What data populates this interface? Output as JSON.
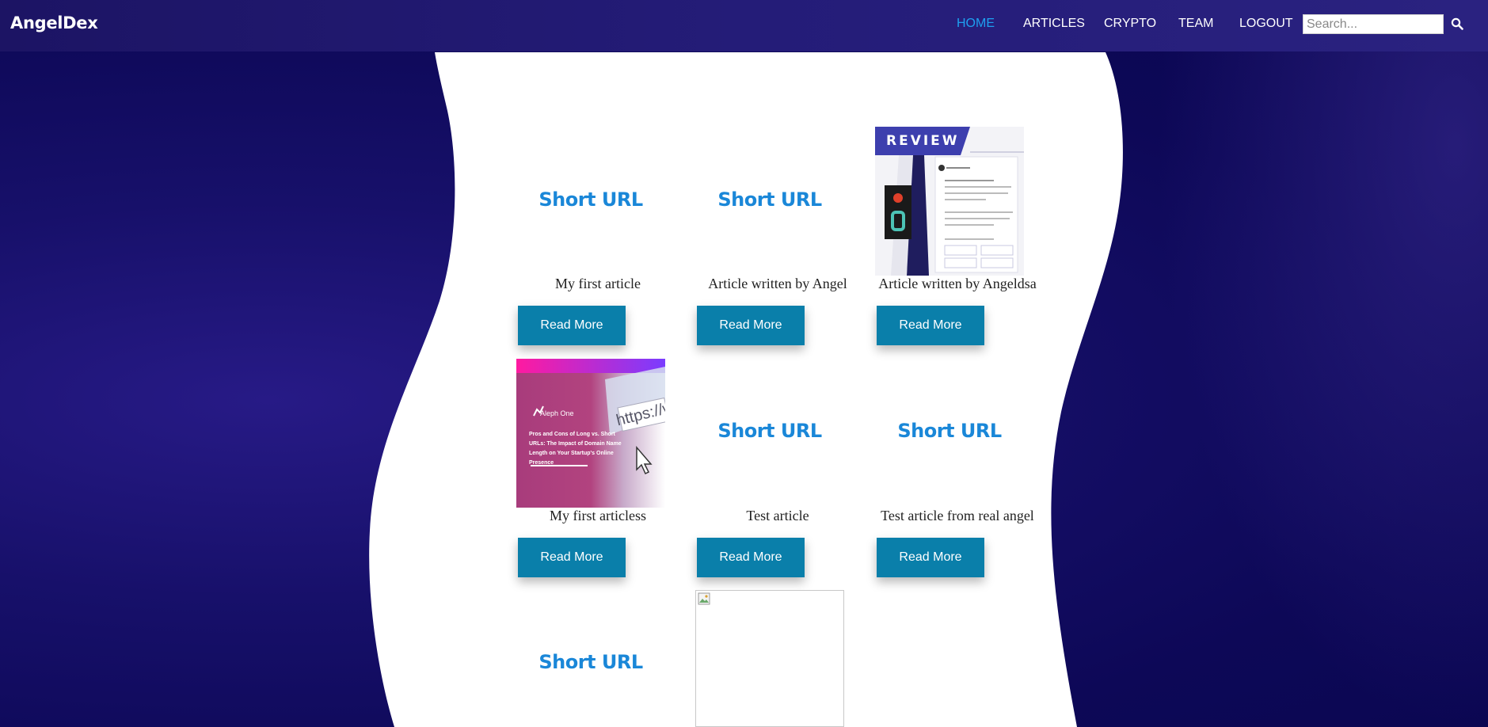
{
  "app": {
    "brand": "AngelDex"
  },
  "nav": {
    "items": [
      {
        "label": "HOME",
        "active": true
      },
      {
        "label": "ARTICLES",
        "active": false
      },
      {
        "label": "CRYPTO",
        "active": false
      },
      {
        "label": "TEAM",
        "active": false
      },
      {
        "label": "LOGOUT",
        "active": false
      }
    ],
    "search": {
      "placeholder": "Search...",
      "value": "",
      "icon": "search-icon"
    }
  },
  "articles": [
    {
      "title": "Short URL",
      "description": "My first article",
      "button": "Read More",
      "media": "text-title"
    },
    {
      "title": "Short URL",
      "description": "Article written by Angel",
      "button": "Read More",
      "media": "text-title"
    },
    {
      "title": "",
      "description": "Article written by Angeldsa",
      "button": "Read More",
      "media": "review-image",
      "image_text": {
        "banner": "REVIEW"
      }
    },
    {
      "title": "",
      "description": "My first articless",
      "button": "Read More",
      "media": "gradient-image",
      "image_text": {
        "logo": "Aleph One",
        "headline": "Pros and Cons of Long vs. Short URLs: The Impact of Domain Name Length on Your Startup's Online Presence",
        "url": "https://www"
      }
    },
    {
      "title": "Short URL",
      "description": "Test article",
      "button": "Read More",
      "media": "text-title"
    },
    {
      "title": "Short URL",
      "description": "Test article from real angel",
      "button": "Read More",
      "media": "text-title"
    },
    {
      "title": "Short URL",
      "description": "",
      "button": "",
      "media": "text-title"
    },
    {
      "title": "",
      "description": "",
      "button": "",
      "media": "broken-image"
    }
  ],
  "colors": {
    "accent_active": "#1ea0f0",
    "title_blue": "#1a87d8",
    "button_bg": "#0a7faa",
    "page_bg": "#0d0857"
  }
}
